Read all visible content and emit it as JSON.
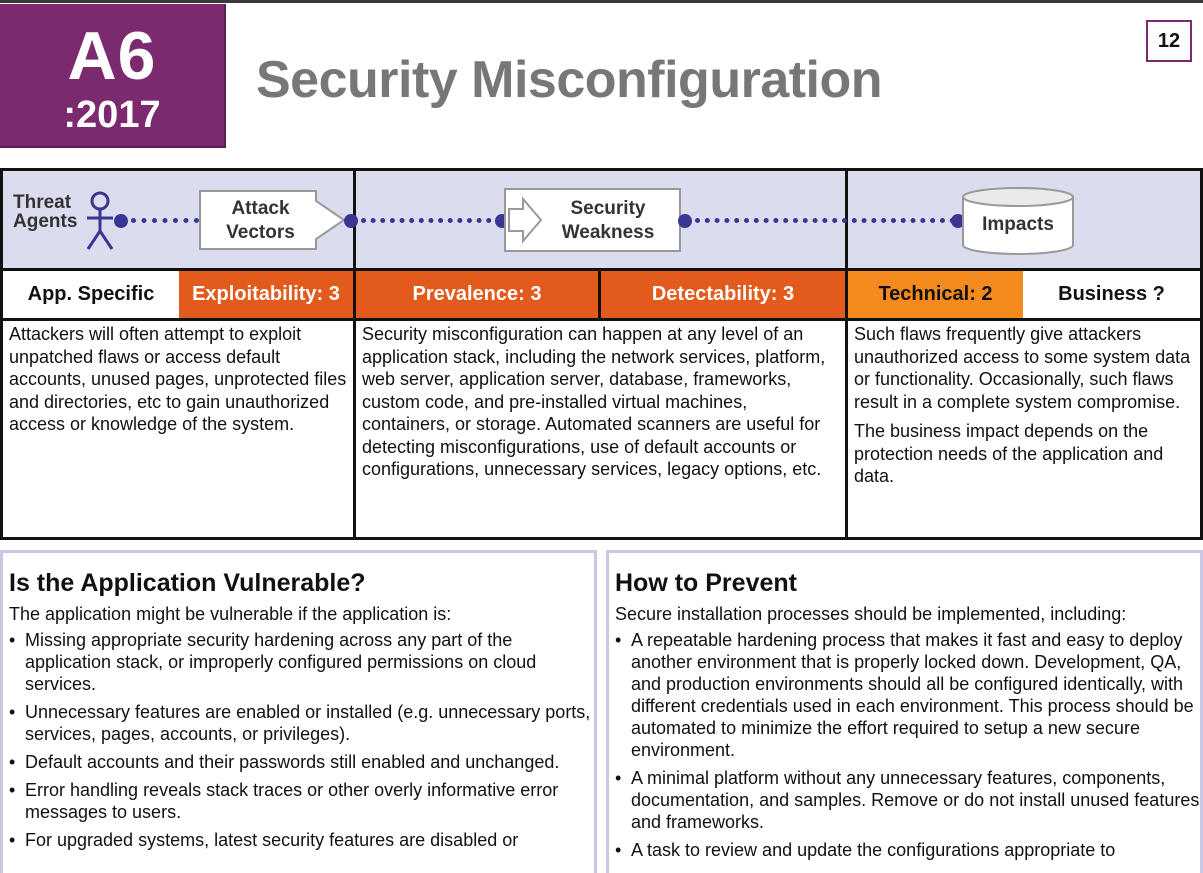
{
  "header": {
    "badge_code": "A6",
    "badge_year": ":2017",
    "title": "Security Misconfiguration",
    "page_number": "12"
  },
  "flow": {
    "threat_agents": "Threat\nAgents",
    "attack_vectors": "Attack\nVectors",
    "security_weakness": "Security\nWeakness",
    "impacts": "Impacts"
  },
  "ratings": {
    "app_specific": "App. Specific",
    "exploitability": "Exploitability: 3",
    "prevalence": "Prevalence: 3",
    "detectability": "Detectability: 3",
    "technical": "Technical: 2",
    "business": "Business ?"
  },
  "colors": {
    "badge": "#7b2a6f",
    "rating_red": "#e35a1d",
    "rating_orange": "#f58a1e",
    "band": "#dcdcef",
    "flow_line": "#3a3694"
  },
  "descriptions": {
    "attack": "Attackers will often attempt to exploit unpatched flaws or access default accounts, unused pages, unprotected files and directories, etc to gain unauthorized access or knowledge of the system.",
    "weakness": "Security misconfiguration can happen at any level of an application stack, including the network services, platform, web server, application server, database, frameworks, custom code, and pre-installed virtual machines, containers, or storage. Automated scanners are useful for detecting misconfigurations, use of default accounts or configurations, unnecessary services, legacy options, etc.",
    "impact_1": "Such flaws frequently give attackers unauthorized access to some system data or functionality. Occasionally, such flaws result in a complete system compromise.",
    "impact_2": "The business impact depends on the protection needs of the application and data."
  },
  "vulnerable": {
    "heading": "Is the Application Vulnerable?",
    "intro": "The application might be vulnerable if the application is:",
    "items": [
      "Missing appropriate security hardening across any part of the application stack, or improperly configured permissions on cloud services.",
      "Unnecessary features are enabled or installed (e.g. unnecessary ports, services, pages, accounts, or privileges).",
      "Default accounts and their passwords still enabled and unchanged.",
      "Error handling reveals stack traces or other overly informative error messages to users.",
      "For upgraded systems, latest security features are disabled or"
    ]
  },
  "prevent": {
    "heading": "How to Prevent",
    "intro": "Secure installation processes should be implemented, including:",
    "items": [
      "A repeatable hardening process that makes it fast and easy to deploy another environment that is properly locked down. Development, QA, and production environments should all be configured identically, with different credentials used in each environment. This process should be automated to minimize the effort required to setup a new secure environment.",
      "A minimal platform without any unnecessary features, components, documentation, and samples. Remove or do not install unused features and frameworks.",
      "A task to review and update the configurations appropriate to"
    ]
  }
}
